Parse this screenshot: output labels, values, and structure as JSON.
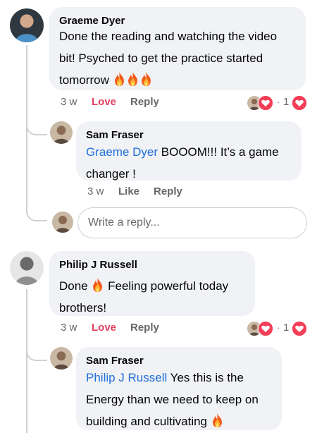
{
  "comments": [
    {
      "author": "Graeme Dyer",
      "lines": [
        "Done the reading and watching the video",
        "bit! Psyched to get the practice started",
        "tomorrow"
      ],
      "time": "3 w",
      "love": "Love",
      "reply": "Reply",
      "reaction_count": "1"
    },
    {
      "author": "Philip J Russell",
      "line1_before": "Done",
      "line1_after": "Feeling powerful today",
      "line2": "brothers!",
      "time": "3 w",
      "love": "Love",
      "reply": "Reply",
      "reaction_count": "1"
    }
  ],
  "replies": [
    {
      "author": "Sam Fraser",
      "mention": "Graeme Dyer",
      "line1_rest": " BOOOM!!! It’s a game",
      "line2": "changer !",
      "time": "3 w",
      "like": "Like",
      "reply": "Reply"
    },
    {
      "author": "Sam Fraser",
      "mention": "Philip J Russell",
      "line1_rest": " Yes this is the",
      "line2": "Energy than we need to keep on",
      "line3": "building and cultivating"
    }
  ],
  "reply_input": {
    "placeholder": "Write a reply..."
  },
  "reaction_dot": "·",
  "colors": {
    "love": "#e4405f",
    "mention": "#216fdb",
    "bubble": "#f0f2f5",
    "meta": "#65676b"
  },
  "icons": [
    "flame-icon",
    "heart-icon",
    "reactor-avatar-icon"
  ]
}
